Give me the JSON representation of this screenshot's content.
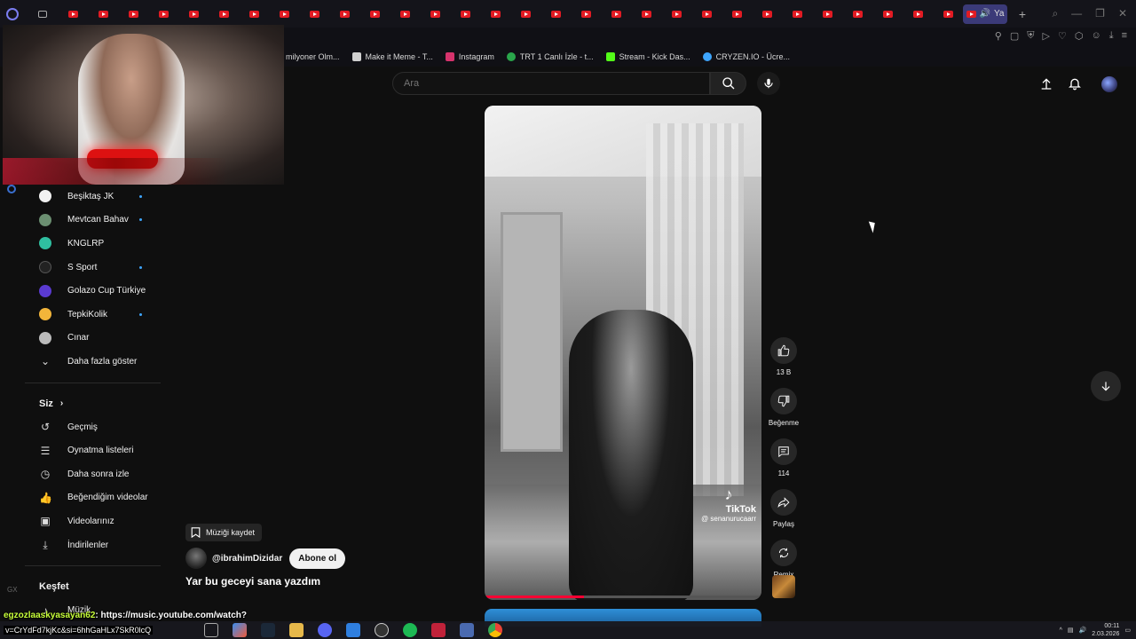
{
  "browser": {
    "active_tab_label": "Ya",
    "bookmarks": [
      {
        "label": "milyoner Olm...",
        "color": "#444"
      },
      {
        "label": "Make it Meme - T...",
        "color": "#d0d0d0"
      },
      {
        "label": "Instagram",
        "color": "#d6336c"
      },
      {
        "label": "TRT 1 Canlı İzle - t...",
        "color": "#2aa64b"
      },
      {
        "label": "Stream - Kick Das...",
        "color": "#53fc18"
      },
      {
        "label": "CRYZEN.IO - Ücre...",
        "color": "#3ea6ff"
      }
    ]
  },
  "search": {
    "placeholder": "Ara"
  },
  "sidebar": {
    "subscriptions": [
      {
        "label": "Beşiktaş JK",
        "color": "#f1f1f1",
        "new": true
      },
      {
        "label": "Mevtcan Bahav",
        "color": "#6b8f71",
        "new": true
      },
      {
        "label": "KNGLRP",
        "color": "#2fbfa0",
        "new": false
      },
      {
        "label": "S Sport",
        "color": "#222222",
        "new": true
      },
      {
        "label": "Golazo Cup Türkiye",
        "color": "#5a3ad0",
        "new": false
      },
      {
        "label": "TepkiKolik",
        "color": "#f2b53a",
        "new": true
      },
      {
        "label": "Cınar",
        "color": "#bbbbbb",
        "new": false
      }
    ],
    "show_more": "Daha fazla göster",
    "you_section": "Siz",
    "you_items": [
      {
        "label": "Geçmiş",
        "icon": "history-icon"
      },
      {
        "label": "Oynatma listeleri",
        "icon": "playlist-icon"
      },
      {
        "label": "Daha sonra izle",
        "icon": "clock-icon"
      },
      {
        "label": "Beğendiğim videolar",
        "icon": "like-icon"
      },
      {
        "label": "Videolarınız",
        "icon": "video-icon"
      },
      {
        "label": "İndirilenler",
        "icon": "download-icon"
      }
    ],
    "explore_section": "Keşfet",
    "explore_items": [
      {
        "label": "Müzik",
        "icon": "music-icon"
      }
    ]
  },
  "short": {
    "tiktok_label": "TikTok",
    "tiktok_handle": "@ senanurucaarr",
    "progress": 0.36,
    "save_music": "Müziği kaydet",
    "channel": "@ibrahimDizidar",
    "subscribe": "Abone ol",
    "title": "Yar bu geceyi sana yazdım"
  },
  "actions": {
    "likes": "13 B",
    "dislike": "Beğenme",
    "comments": "114",
    "share": "Paylaş",
    "remix": "Remix"
  },
  "chat": {
    "user": "egzozlaaskyasayan62",
    "message": ": https://music.youtube.com/watch?",
    "line2": "v=CrYdFd7kjKc&si=6hhGaHLx7SkR0lcQ"
  },
  "taskbar": {
    "time": "00:11",
    "date": "2.03.2026"
  },
  "colors": {
    "accent_red": "#ff0033",
    "new_dot": "#3ea6ff",
    "chat_user": "#c8ff3a"
  }
}
